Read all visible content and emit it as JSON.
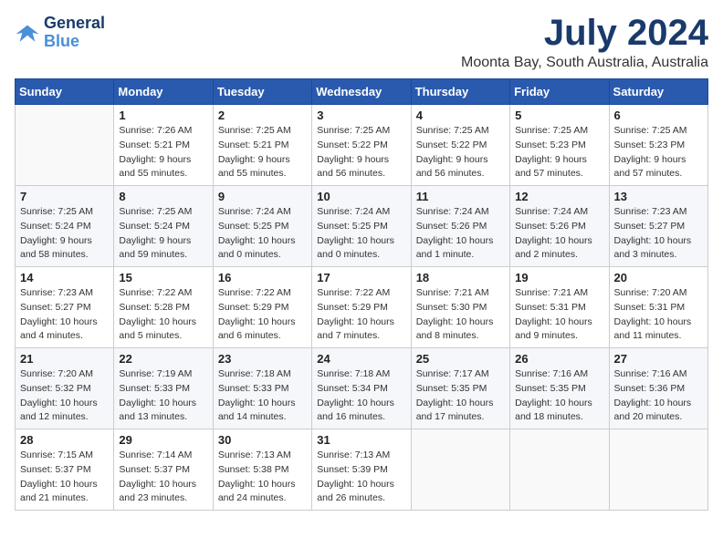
{
  "logo": {
    "line1": "General",
    "line2": "Blue"
  },
  "title": "July 2024",
  "location": "Moonta Bay, South Australia, Australia",
  "weekdays": [
    "Sunday",
    "Monday",
    "Tuesday",
    "Wednesday",
    "Thursday",
    "Friday",
    "Saturday"
  ],
  "weeks": [
    [
      {
        "day": "",
        "info": ""
      },
      {
        "day": "1",
        "info": "Sunrise: 7:26 AM\nSunset: 5:21 PM\nDaylight: 9 hours\nand 55 minutes."
      },
      {
        "day": "2",
        "info": "Sunrise: 7:25 AM\nSunset: 5:21 PM\nDaylight: 9 hours\nand 55 minutes."
      },
      {
        "day": "3",
        "info": "Sunrise: 7:25 AM\nSunset: 5:22 PM\nDaylight: 9 hours\nand 56 minutes."
      },
      {
        "day": "4",
        "info": "Sunrise: 7:25 AM\nSunset: 5:22 PM\nDaylight: 9 hours\nand 56 minutes."
      },
      {
        "day": "5",
        "info": "Sunrise: 7:25 AM\nSunset: 5:23 PM\nDaylight: 9 hours\nand 57 minutes."
      },
      {
        "day": "6",
        "info": "Sunrise: 7:25 AM\nSunset: 5:23 PM\nDaylight: 9 hours\nand 57 minutes."
      }
    ],
    [
      {
        "day": "7",
        "info": "Sunrise: 7:25 AM\nSunset: 5:24 PM\nDaylight: 9 hours\nand 58 minutes."
      },
      {
        "day": "8",
        "info": "Sunrise: 7:25 AM\nSunset: 5:24 PM\nDaylight: 9 hours\nand 59 minutes."
      },
      {
        "day": "9",
        "info": "Sunrise: 7:24 AM\nSunset: 5:25 PM\nDaylight: 10 hours\nand 0 minutes."
      },
      {
        "day": "10",
        "info": "Sunrise: 7:24 AM\nSunset: 5:25 PM\nDaylight: 10 hours\nand 0 minutes."
      },
      {
        "day": "11",
        "info": "Sunrise: 7:24 AM\nSunset: 5:26 PM\nDaylight: 10 hours\nand 1 minute."
      },
      {
        "day": "12",
        "info": "Sunrise: 7:24 AM\nSunset: 5:26 PM\nDaylight: 10 hours\nand 2 minutes."
      },
      {
        "day": "13",
        "info": "Sunrise: 7:23 AM\nSunset: 5:27 PM\nDaylight: 10 hours\nand 3 minutes."
      }
    ],
    [
      {
        "day": "14",
        "info": "Sunrise: 7:23 AM\nSunset: 5:27 PM\nDaylight: 10 hours\nand 4 minutes."
      },
      {
        "day": "15",
        "info": "Sunrise: 7:22 AM\nSunset: 5:28 PM\nDaylight: 10 hours\nand 5 minutes."
      },
      {
        "day": "16",
        "info": "Sunrise: 7:22 AM\nSunset: 5:29 PM\nDaylight: 10 hours\nand 6 minutes."
      },
      {
        "day": "17",
        "info": "Sunrise: 7:22 AM\nSunset: 5:29 PM\nDaylight: 10 hours\nand 7 minutes."
      },
      {
        "day": "18",
        "info": "Sunrise: 7:21 AM\nSunset: 5:30 PM\nDaylight: 10 hours\nand 8 minutes."
      },
      {
        "day": "19",
        "info": "Sunrise: 7:21 AM\nSunset: 5:31 PM\nDaylight: 10 hours\nand 9 minutes."
      },
      {
        "day": "20",
        "info": "Sunrise: 7:20 AM\nSunset: 5:31 PM\nDaylight: 10 hours\nand 11 minutes."
      }
    ],
    [
      {
        "day": "21",
        "info": "Sunrise: 7:20 AM\nSunset: 5:32 PM\nDaylight: 10 hours\nand 12 minutes."
      },
      {
        "day": "22",
        "info": "Sunrise: 7:19 AM\nSunset: 5:33 PM\nDaylight: 10 hours\nand 13 minutes."
      },
      {
        "day": "23",
        "info": "Sunrise: 7:18 AM\nSunset: 5:33 PM\nDaylight: 10 hours\nand 14 minutes."
      },
      {
        "day": "24",
        "info": "Sunrise: 7:18 AM\nSunset: 5:34 PM\nDaylight: 10 hours\nand 16 minutes."
      },
      {
        "day": "25",
        "info": "Sunrise: 7:17 AM\nSunset: 5:35 PM\nDaylight: 10 hours\nand 17 minutes."
      },
      {
        "day": "26",
        "info": "Sunrise: 7:16 AM\nSunset: 5:35 PM\nDaylight: 10 hours\nand 18 minutes."
      },
      {
        "day": "27",
        "info": "Sunrise: 7:16 AM\nSunset: 5:36 PM\nDaylight: 10 hours\nand 20 minutes."
      }
    ],
    [
      {
        "day": "28",
        "info": "Sunrise: 7:15 AM\nSunset: 5:37 PM\nDaylight: 10 hours\nand 21 minutes."
      },
      {
        "day": "29",
        "info": "Sunrise: 7:14 AM\nSunset: 5:37 PM\nDaylight: 10 hours\nand 23 minutes."
      },
      {
        "day": "30",
        "info": "Sunrise: 7:13 AM\nSunset: 5:38 PM\nDaylight: 10 hours\nand 24 minutes."
      },
      {
        "day": "31",
        "info": "Sunrise: 7:13 AM\nSunset: 5:39 PM\nDaylight: 10 hours\nand 26 minutes."
      },
      {
        "day": "",
        "info": ""
      },
      {
        "day": "",
        "info": ""
      },
      {
        "day": "",
        "info": ""
      }
    ]
  ]
}
